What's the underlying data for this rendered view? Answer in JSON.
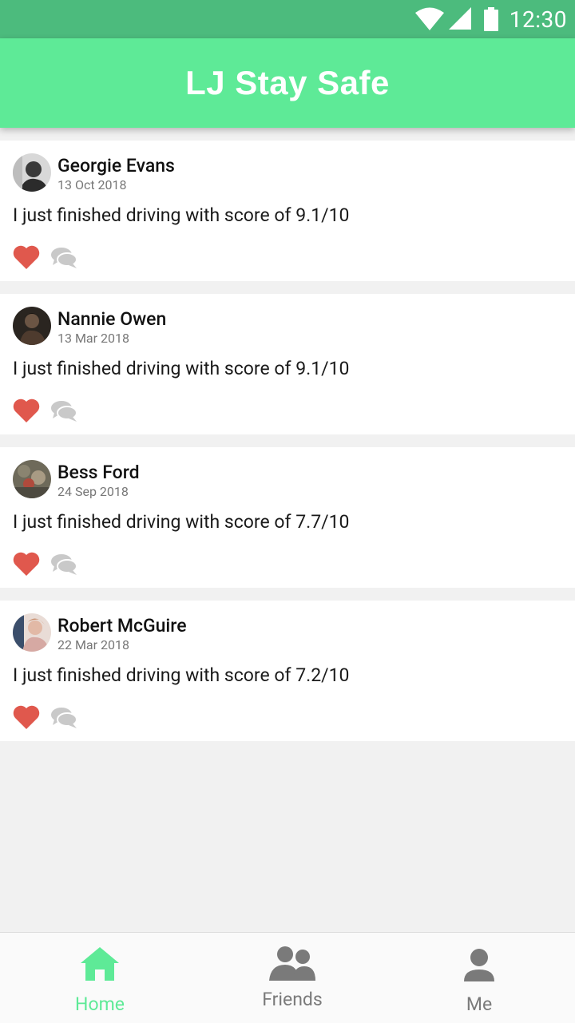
{
  "status_bar": {
    "time": "12:30"
  },
  "app": {
    "title": "LJ Stay Safe"
  },
  "colors": {
    "status_bar": "#4cbb7d",
    "app_bar": "#5eea97",
    "heart": "#e0584d",
    "comment": "#c9c9c9",
    "nav_active": "#5eea97",
    "nav_inactive": "#7a7a7a"
  },
  "feed": {
    "posts": [
      {
        "name": "Georgie Evans",
        "date": "13 Oct 2018",
        "text": "I just finished driving with score of 9.1/10"
      },
      {
        "name": "Nannie Owen",
        "date": "13 Mar 2018",
        "text": "I just finished driving with score of 9.1/10"
      },
      {
        "name": "Bess Ford",
        "date": "24 Sep 2018",
        "text": "I just finished driving with score of 7.7/10"
      },
      {
        "name": "Robert McGuire",
        "date": "22 Mar 2018",
        "text": "I just finished driving with score of 7.2/10"
      }
    ]
  },
  "bottom_nav": {
    "items": [
      {
        "label": "Home",
        "icon": "home-icon",
        "active": true
      },
      {
        "label": "Friends",
        "icon": "people-icon",
        "active": false
      },
      {
        "label": "Me",
        "icon": "person-icon",
        "active": false
      }
    ]
  }
}
